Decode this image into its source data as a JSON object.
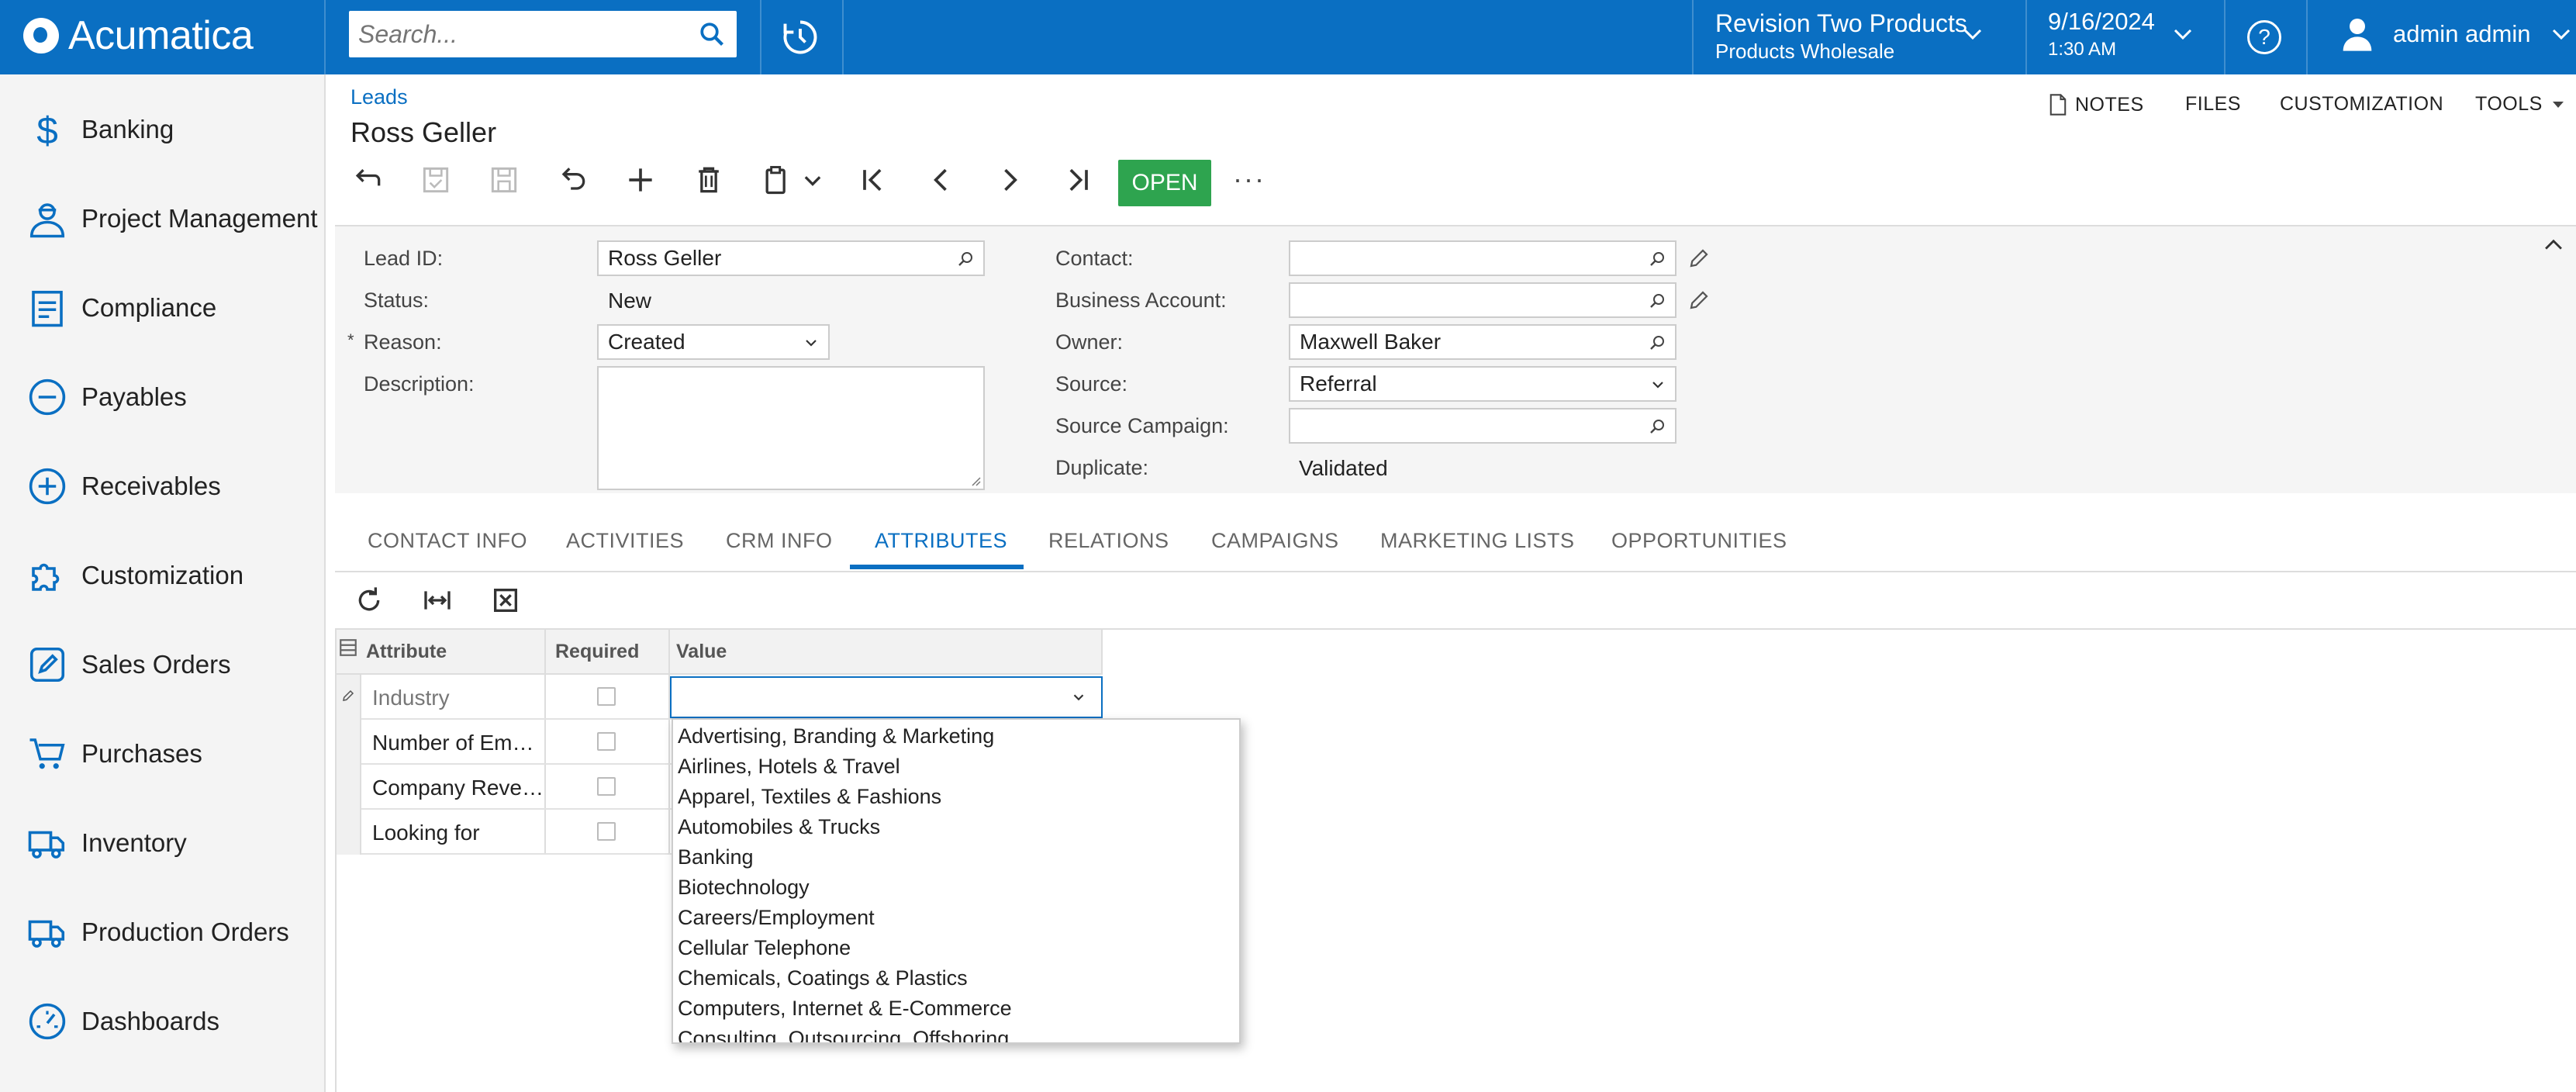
{
  "header": {
    "logo_text": "Acumatica",
    "search_placeholder": "Search...",
    "company": {
      "name": "Revision Two Products",
      "branch": "Products Wholesale"
    },
    "date": "9/16/2024",
    "time": "1:30 AM",
    "user": "admin admin"
  },
  "sidebar": {
    "items": [
      {
        "label": "Banking",
        "icon": "dollar-icon"
      },
      {
        "label": "Project Management",
        "icon": "worker-icon"
      },
      {
        "label": "Compliance",
        "icon": "checklist-icon"
      },
      {
        "label": "Payables",
        "icon": "minus-circle-icon"
      },
      {
        "label": "Receivables",
        "icon": "plus-circle-icon"
      },
      {
        "label": "Customization",
        "icon": "puzzle-icon"
      },
      {
        "label": "Sales Orders",
        "icon": "edit-icon"
      },
      {
        "label": "Purchases",
        "icon": "cart-icon"
      },
      {
        "label": "Inventory",
        "icon": "truck-icon"
      },
      {
        "label": "Production Orders",
        "icon": "truck-icon"
      },
      {
        "label": "Dashboards",
        "icon": "gauge-icon"
      }
    ]
  },
  "page": {
    "breadcrumb": "Leads",
    "title": "Ross Geller",
    "actions": {
      "notes": "NOTES",
      "files": "FILES",
      "customization": "CUSTOMIZATION",
      "tools": "TOOLS"
    },
    "open_button": "OPEN",
    "more": "···"
  },
  "form": {
    "lead_id_label": "Lead ID:",
    "lead_id": "Ross Geller",
    "status_label": "Status:",
    "status": "New",
    "reason_required": "*",
    "reason_label": "Reason:",
    "reason": "Created",
    "description_label": "Description:",
    "description": "",
    "contact_label": "Contact:",
    "contact": "",
    "business_account_label": "Business Account:",
    "business_account": "",
    "owner_label": "Owner:",
    "owner": "Maxwell Baker",
    "source_label": "Source:",
    "source": "Referral",
    "source_campaign_label": "Source Campaign:",
    "source_campaign": "",
    "duplicate_label": "Duplicate:",
    "duplicate": "Validated"
  },
  "tabs": [
    {
      "label": "CONTACT INFO"
    },
    {
      "label": "ACTIVITIES"
    },
    {
      "label": "CRM INFO"
    },
    {
      "label": "ATTRIBUTES",
      "active": true
    },
    {
      "label": "RELATIONS"
    },
    {
      "label": "CAMPAIGNS"
    },
    {
      "label": "MARKETING LISTS"
    },
    {
      "label": "OPPORTUNITIES"
    }
  ],
  "grid": {
    "columns": [
      "Attribute",
      "Required",
      "Value"
    ],
    "rows": [
      {
        "attribute": "Industry",
        "required": false,
        "value": ""
      },
      {
        "attribute": "Number of Em…",
        "required": false,
        "value": ""
      },
      {
        "attribute": "Company Reve…",
        "required": false,
        "value": ""
      },
      {
        "attribute": "Looking for",
        "required": false,
        "value": ""
      }
    ]
  },
  "dropdown": {
    "options": [
      "Advertising, Branding & Marketing",
      "Airlines, Hotels & Travel",
      "Apparel, Textiles & Fashions",
      "Automobiles & Trucks",
      "Banking",
      "Biotechnology",
      "Careers/Employment",
      "Cellular Telephone",
      "Chemicals, Coatings & Plastics",
      "Computers, Internet & E-Commerce",
      "Consulting, Outsourcing, Offshoring"
    ]
  },
  "colors": {
    "brand": "#0a6fc2",
    "open_button": "#2ea44f"
  }
}
